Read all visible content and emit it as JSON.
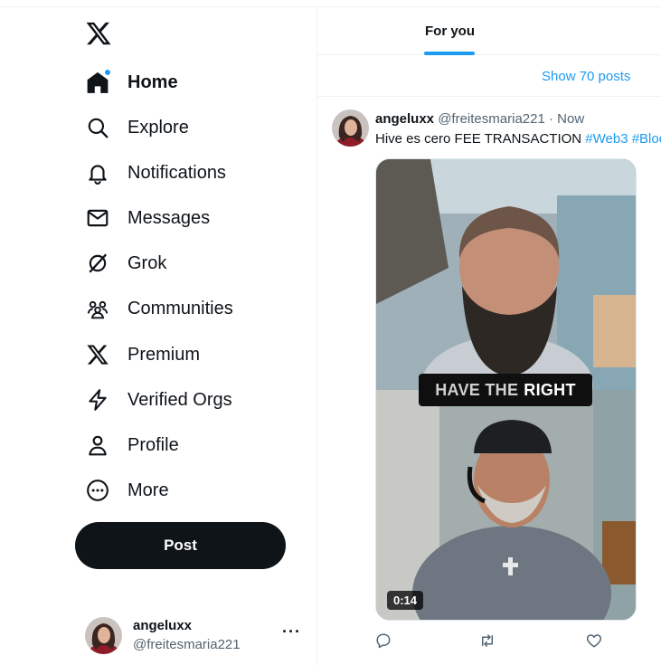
{
  "sidebar": {
    "logo_icon": "x-logo-icon",
    "items": [
      {
        "label": "Home",
        "icon": "home-icon",
        "active": true
      },
      {
        "label": "Explore",
        "icon": "search-icon"
      },
      {
        "label": "Notifications",
        "icon": "bell-icon"
      },
      {
        "label": "Messages",
        "icon": "mail-icon"
      },
      {
        "label": "Grok",
        "icon": "grok-icon"
      },
      {
        "label": "Communities",
        "icon": "communities-icon"
      },
      {
        "label": "Premium",
        "icon": "x-logo-icon"
      },
      {
        "label": "Verified Orgs",
        "icon": "lightning-icon"
      },
      {
        "label": "Profile",
        "icon": "person-icon"
      },
      {
        "label": "More",
        "icon": "more-circle-icon"
      }
    ],
    "post_button": "Post",
    "account": {
      "name": "angeluxx",
      "handle": "@freitesmaria221",
      "more": "···"
    }
  },
  "timeline": {
    "tabs": [
      {
        "label": "For you",
        "active": true
      }
    ],
    "show_posts": "Show 70 posts",
    "tweet": {
      "author_name": "angeluxx",
      "author_meta": "@freitesmaria221 · Now",
      "text": "Hive es cero FEE TRANSACTION ",
      "hashtags": "#Web3 #Bloc",
      "media": {
        "overlay_text": "HAVE THE",
        "overlay_highlight": "RIGHT",
        "duration": "0:14"
      },
      "actions": [
        "reply-icon",
        "retweet-icon",
        "like-icon"
      ]
    }
  },
  "colors": {
    "accent": "#1d9bf0",
    "text": "#0f1419",
    "muted": "#536471",
    "divider": "#eff3f4"
  }
}
